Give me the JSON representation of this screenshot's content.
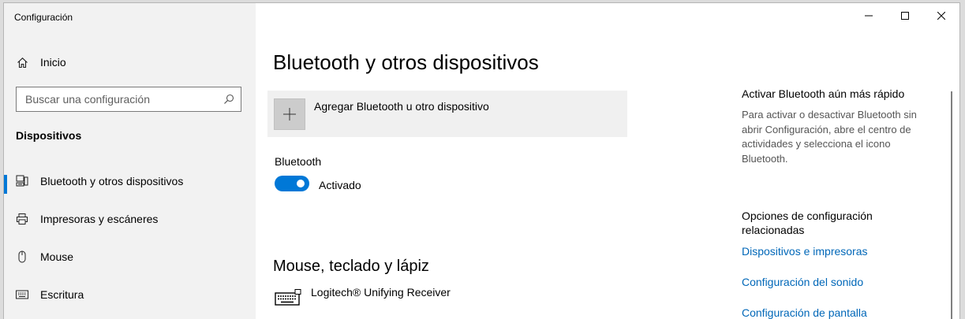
{
  "window": {
    "app_title": "Configuración"
  },
  "sidebar": {
    "home_label": "Inicio",
    "search_placeholder": "Buscar una configuración",
    "section_heading": "Dispositivos",
    "items": [
      {
        "label": "Bluetooth y otros dispositivos",
        "icon": "bluetooth-devices-icon",
        "active": true
      },
      {
        "label": "Impresoras y escáneres",
        "icon": "printer-icon",
        "active": false
      },
      {
        "label": "Mouse",
        "icon": "mouse-icon",
        "active": false
      },
      {
        "label": "Escritura",
        "icon": "keyboard-icon",
        "active": false
      }
    ]
  },
  "main": {
    "page_title": "Bluetooth y otros dispositivos",
    "add_device_label": "Agregar Bluetooth u otro dispositivo",
    "bluetooth_label": "Bluetooth",
    "bluetooth_state": "Activado",
    "bluetooth_on": true,
    "section_title": "Mouse, teclado y lápiz",
    "devices": [
      {
        "name": "Logitech® Unifying Receiver",
        "icon": "keyboard-icon"
      }
    ]
  },
  "aside": {
    "tip_heading": "Activar Bluetooth aún más rápido",
    "tip_text": "Para activar o desactivar Bluetooth sin abrir Configuración, abre el centro de actividades y selecciona el icono Bluetooth.",
    "related_heading": "Opciones de configuración relacionadas",
    "links": [
      "Dispositivos e impresoras",
      "Configuración del sonido",
      "Configuración de pantalla"
    ]
  },
  "colors": {
    "accent": "#0078d7",
    "link": "#0067b8",
    "sidebar_bg": "#f2f2f2"
  }
}
